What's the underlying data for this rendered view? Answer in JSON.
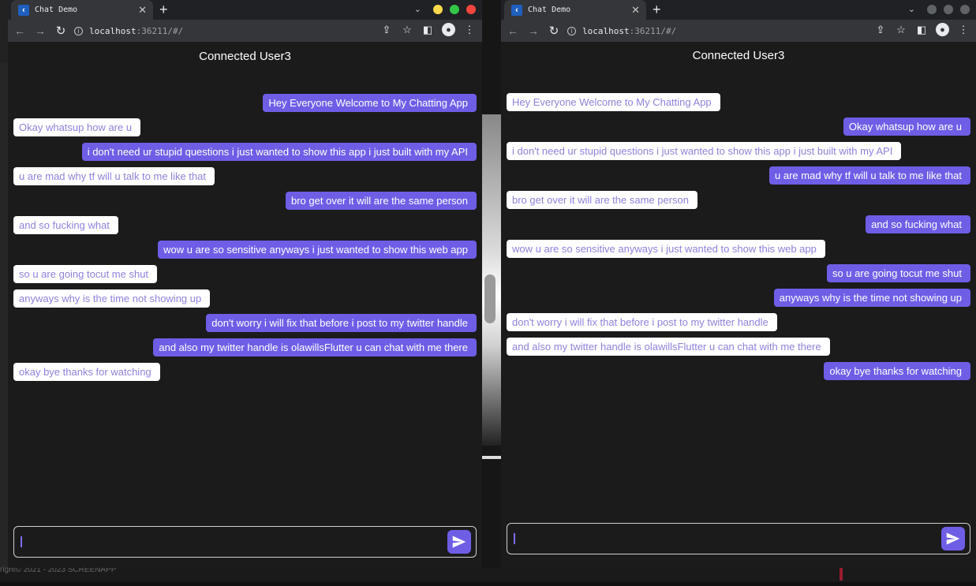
{
  "windows": [
    {
      "tab_title": "Chat Demo",
      "url_host": "localhost",
      "url_rest": ":36211/#/",
      "app_title": "Connected User3",
      "messages": [
        {
          "text": "Hey Everyone Welcome to My Chatting App",
          "mine": true
        },
        {
          "text": "Okay whatsup how are u",
          "mine": false
        },
        {
          "text": "i don't need ur stupid questions i just wanted to show this app i just built with my API",
          "mine": true
        },
        {
          "text": "u are mad why tf will u talk to me like that",
          "mine": false
        },
        {
          "text": "bro get over it will are the same person",
          "mine": true
        },
        {
          "text": "and so fucking what",
          "mine": false
        },
        {
          "text": "wow u are so sensitive anyways i just wanted to show this web app",
          "mine": true
        },
        {
          "text": "so u are going tocut me shut",
          "mine": false
        },
        {
          "text": "anyways why is the time not showing up",
          "mine": false
        },
        {
          "text": "don't worry i will fix that before i post to my twitter handle",
          "mine": true
        },
        {
          "text": "and also my twitter handle is olawillsFlutter u can chat with me there",
          "mine": true
        },
        {
          "text": "okay bye thanks for watching",
          "mine": false
        }
      ],
      "input_value": "",
      "traffic_colors": [
        "#fdd94c",
        "#33c748",
        "#f1453d"
      ]
    },
    {
      "tab_title": "Chat Demo",
      "url_host": "localhost",
      "url_rest": ":36211/#/",
      "app_title": "Connected User3",
      "messages": [
        {
          "text": "Hey Everyone Welcome to My Chatting App",
          "mine": false
        },
        {
          "text": "Okay whatsup how are u",
          "mine": true
        },
        {
          "text": "i don't need ur stupid questions i just wanted to show this app i just built with my API",
          "mine": false
        },
        {
          "text": "u are mad why tf will u talk to me like that",
          "mine": true
        },
        {
          "text": "bro get over it will are the same person",
          "mine": false
        },
        {
          "text": "and so fucking what",
          "mine": true
        },
        {
          "text": "wow u are so sensitive anyways i just wanted to show this web app",
          "mine": false
        },
        {
          "text": "so u are going tocut me shut",
          "mine": true
        },
        {
          "text": "anyways why is the time not showing up",
          "mine": true
        },
        {
          "text": "don't worry i will fix that before i post to my twitter handle",
          "mine": false
        },
        {
          "text": "and also my twitter handle is olawillsFlutter u can chat with me there",
          "mine": false
        },
        {
          "text": "okay bye thanks for watching",
          "mine": true
        }
      ],
      "input_value": "",
      "traffic_colors": [
        "#5f6368",
        "#5f6368",
        "#5f6368"
      ]
    }
  ],
  "background": {
    "footer_text": "right©   2021 - 2023 SCREENAPP"
  },
  "colors": {
    "accent": "#6e5ee6",
    "bubble_other": "#ffffff",
    "bubble_other_text": "#8e82dc",
    "app_background": "#1b1b1c"
  },
  "icons": {
    "back": "arrow-left-icon",
    "forward": "arrow-right-icon",
    "reload": "reload-icon",
    "info": "info-icon",
    "share": "share-icon",
    "bookmark": "star-icon",
    "sidepanel": "side-panel-icon",
    "profile": "profile-icon",
    "menu": "kebab-menu-icon",
    "send": "send-icon"
  }
}
